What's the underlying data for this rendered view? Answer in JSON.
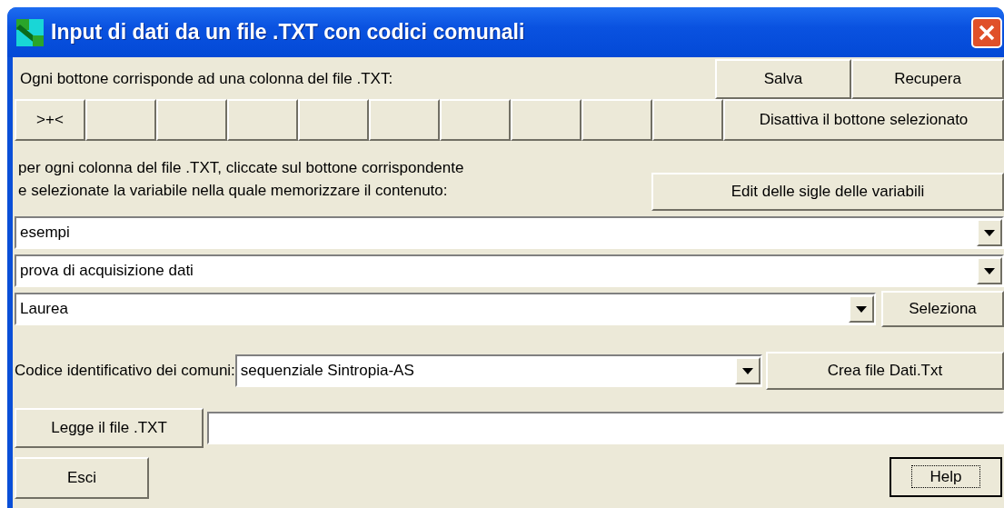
{
  "window": {
    "title": "Input di dati da un file .TXT con codici comunali"
  },
  "header": {
    "text": "Ogni bottone corrisponde ad una colonna del file .TXT:",
    "buttons": [
      "Salva",
      "Recupera"
    ]
  },
  "column_buttons": [
    {
      "kind": "label",
      "label": ">+<"
    },
    {
      "kind": "empty"
    },
    {
      "kind": "empty"
    },
    {
      "kind": "empty"
    },
    {
      "kind": "empty"
    },
    {
      "kind": "empty"
    },
    {
      "kind": "empty"
    },
    {
      "kind": "empty"
    },
    {
      "kind": "empty"
    },
    {
      "kind": "empty"
    }
  ],
  "disable_button": "Disattiva il bottone selezionato",
  "instructions": [
    "per ogni colonna del file .TXT, cliccate sul bottone corrispondente",
    "e selezionate la variabile nella quale memorizzare il contenuto:"
  ],
  "edit_button": "Edit delle sigle delle variabili",
  "dropdowns": [
    {
      "value": "esempi"
    },
    {
      "value": "prova di acquisizione dati"
    },
    {
      "value": "Laurea",
      "button": "Seleziona"
    }
  ],
  "code_row": {
    "label": "Codice identificativo dei comuni:",
    "value": "sequenziale Sintropia-AS",
    "button": "Crea file Dati.Txt"
  },
  "read_row": {
    "button": "Legge il file .TXT"
  },
  "footer": [
    {
      "label": "Esci",
      "focused": false
    },
    {
      "label": "Help",
      "focused": true
    }
  ]
}
